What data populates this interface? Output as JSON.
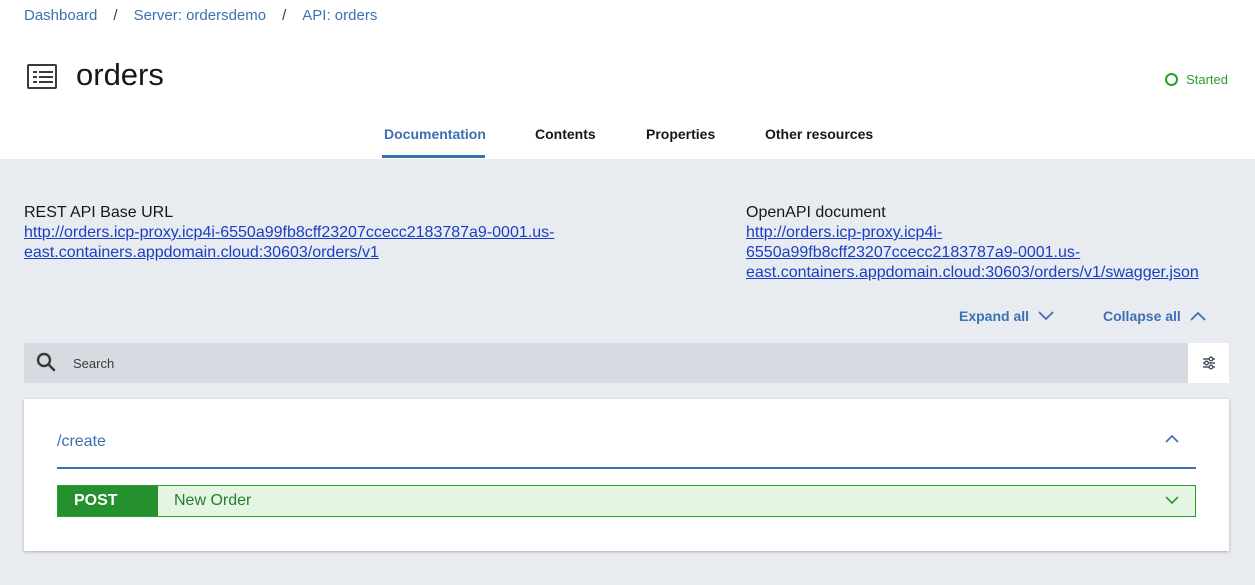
{
  "breadcrumb": [
    {
      "label": "Dashboard"
    },
    {
      "label": "Server: ordersdemo"
    },
    {
      "label": "API: orders"
    }
  ],
  "breadcrumb_separator": "/",
  "header": {
    "title": "orders",
    "status": "Started",
    "status_color": "#2a9d2a"
  },
  "tabs": [
    {
      "label": "Documentation",
      "active": true
    },
    {
      "label": "Contents",
      "active": false
    },
    {
      "label": "Properties",
      "active": false
    },
    {
      "label": "Other resources",
      "active": false
    }
  ],
  "rest_api": {
    "label": "REST API Base URL",
    "url_line1": "http://orders.icp-proxy.icp4i-6550a99fb8cff23207ccecc2183787a9-0001.us-",
    "url_line2": "east.containers.appdomain.cloud:30603/orders/v1"
  },
  "openapi": {
    "label": "OpenAPI document",
    "url_line1": "http://orders.icp-proxy.icp4i-",
    "url_line2": "6550a99fb8cff23207ccecc2183787a9-0001.us-",
    "url_line3": "east.containers.appdomain.cloud:30603/orders/v1/swagger.json"
  },
  "actions": {
    "expand_all": "Expand all",
    "collapse_all": "Collapse all"
  },
  "search": {
    "placeholder": "Search"
  },
  "paths": [
    {
      "path": "/create",
      "operations": [
        {
          "method": "POST",
          "summary": "New Order",
          "color": "#24902e"
        }
      ]
    }
  ],
  "icons": {
    "page": "document-list-icon",
    "status": "status-circle-icon",
    "search": "search-icon",
    "filter": "filter-settings-icon"
  },
  "colors": {
    "accent": "#3d70b2",
    "link": "#1a3fc4",
    "post": "#24902e"
  }
}
